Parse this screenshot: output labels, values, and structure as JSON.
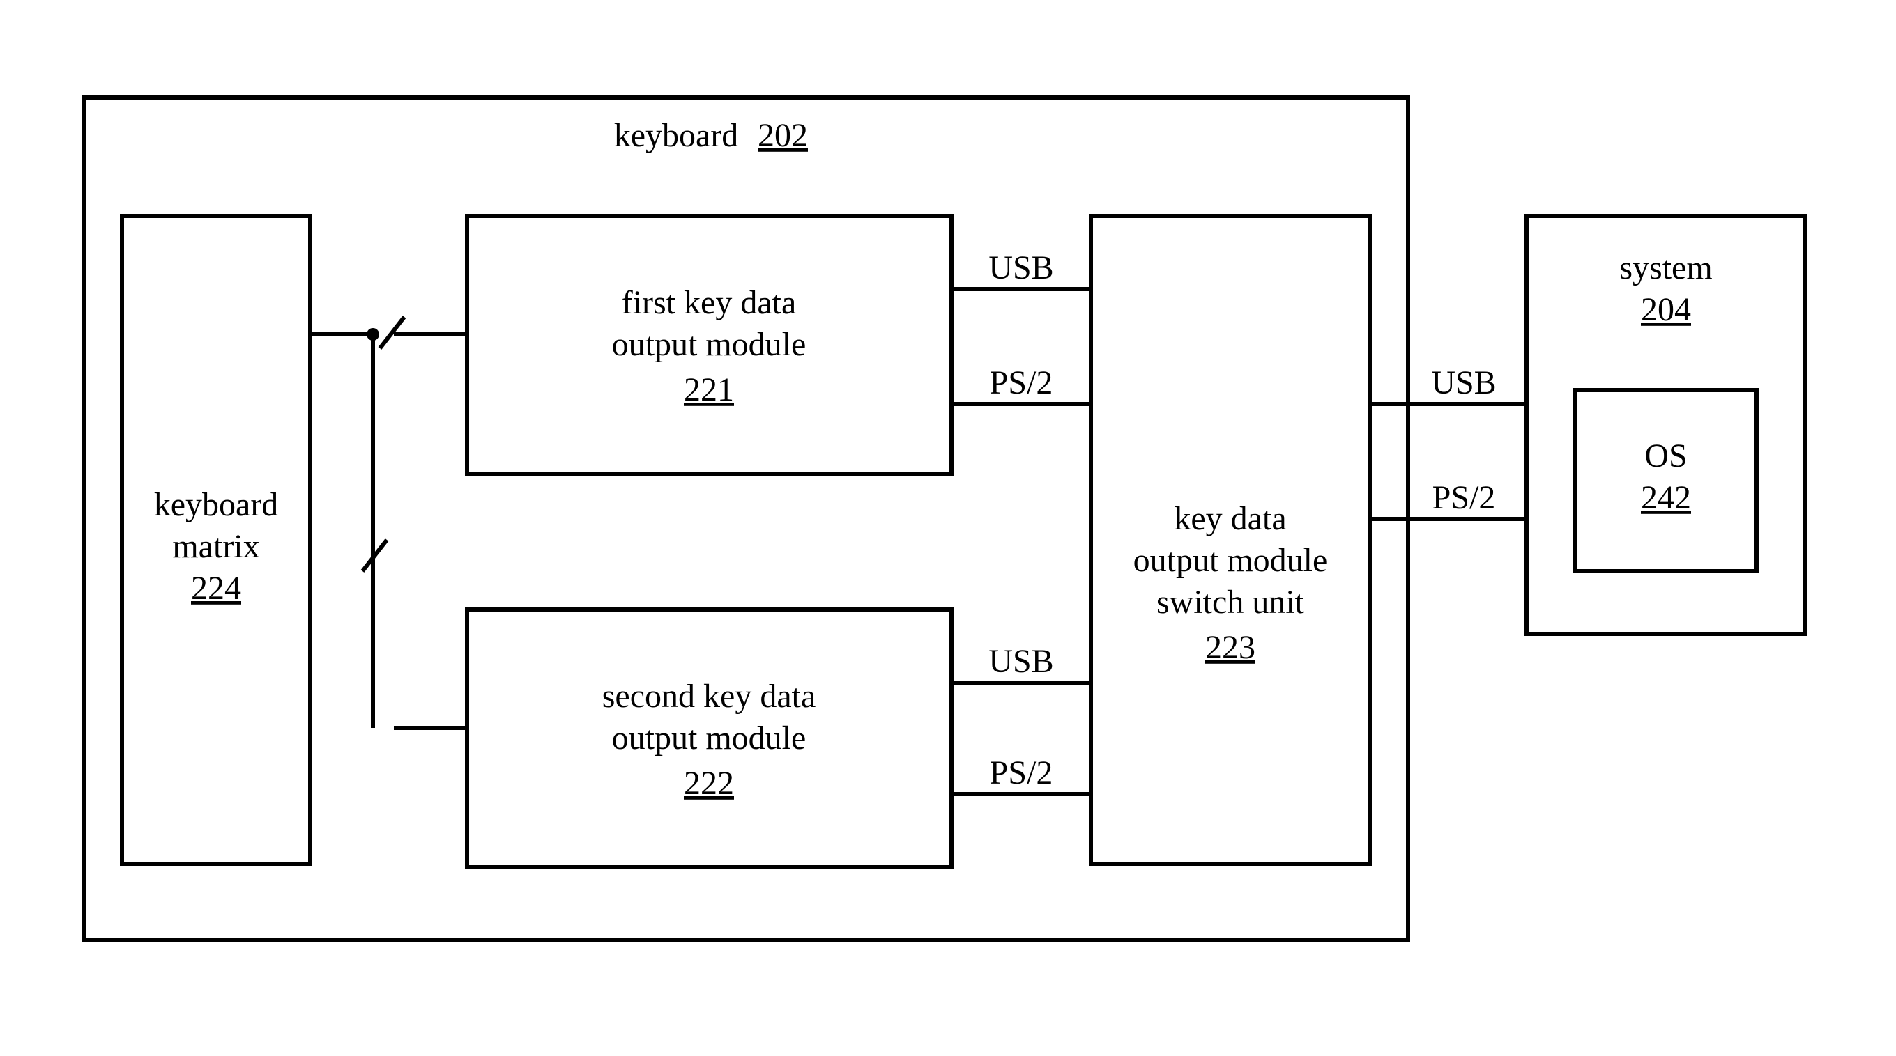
{
  "keyboard": {
    "label": "keyboard",
    "ref": "202"
  },
  "matrix": {
    "label_l1": "keyboard",
    "label_l2": "matrix",
    "ref": "224"
  },
  "mod1": {
    "label_l1": "first key data",
    "label_l2": "output module",
    "ref": "221"
  },
  "mod2": {
    "label_l1": "second key data",
    "label_l2": "output module",
    "ref": "222"
  },
  "switch": {
    "label_l1": "key data",
    "label_l2": "output module",
    "label_l3": "switch unit",
    "ref": "223"
  },
  "system": {
    "label": "system",
    "ref": "204"
  },
  "os": {
    "label": "OS",
    "ref": "242"
  },
  "bus": {
    "usb": "USB",
    "ps2": "PS/2"
  }
}
